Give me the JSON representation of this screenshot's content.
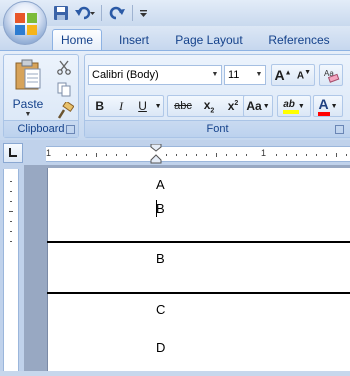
{
  "ribbon_tabs": [
    "Home",
    "Insert",
    "Page Layout",
    "References"
  ],
  "active_tab": "Home",
  "clipboard": {
    "paste_label": "Paste",
    "group_label": "Clipboard"
  },
  "font": {
    "name": "Calibri (Body)",
    "size": "11",
    "group_label": "Font",
    "grow_label": "A",
    "shrink_label": "A",
    "bold": "B",
    "italic": "I",
    "underline": "U",
    "strikethrough": "abc",
    "subscript": "x",
    "subscript_mark": "2",
    "superscript": "x",
    "superscript_mark": "2",
    "change_case": "Aa",
    "highlight": "ab",
    "font_color": "A",
    "highlight_color": "#ffff00",
    "font_color_swatch": "#ff0000"
  },
  "ruler": {
    "marks": [
      "1",
      "1"
    ]
  },
  "document": {
    "rows": [
      {
        "lines": [
          "A",
          "B"
        ]
      },
      {
        "lines": [
          "B"
        ]
      },
      {
        "lines": [
          "C",
          "D"
        ]
      }
    ]
  }
}
